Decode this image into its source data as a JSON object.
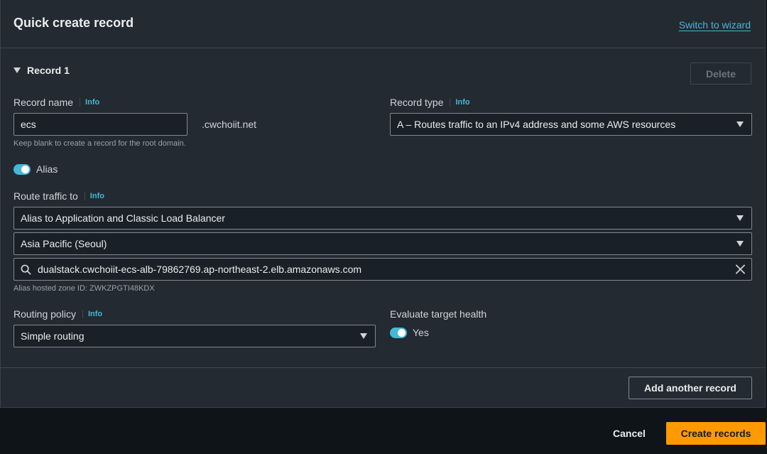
{
  "header": {
    "title": "Quick create record",
    "switch_link": "Switch to wizard"
  },
  "record": {
    "section_label": "Record 1",
    "delete_label": "Delete",
    "record_name": {
      "label": "Record name",
      "info": "Info",
      "value": "ecs",
      "suffix": ".cwchoiit.net",
      "hint": "Keep blank to create a record for the root domain."
    },
    "record_type": {
      "label": "Record type",
      "info": "Info",
      "value": "A – Routes traffic to an IPv4 address and some AWS resources"
    },
    "alias": {
      "label": "Alias",
      "enabled": true
    },
    "route_traffic": {
      "label": "Route traffic to",
      "info": "Info",
      "endpoint_type": "Alias to Application and Classic Load Balancer",
      "region": "Asia Pacific (Seoul)",
      "target": "dualstack.cwchoiit-ecs-alb-79862769.ap-northeast-2.elb.amazonaws.com",
      "hosted_zone": "Alias hosted zone ID: ZWKZPGTI48KDX"
    },
    "routing_policy": {
      "label": "Routing policy",
      "info": "Info",
      "value": "Simple routing"
    },
    "evaluate_health": {
      "label": "Evaluate target health",
      "toggle_label": "Yes",
      "enabled": true
    }
  },
  "actions": {
    "add_record": "Add another record",
    "cancel": "Cancel",
    "create": "Create records"
  },
  "colors": {
    "accent": "#44b9d6",
    "primary_button": "#ff9900"
  }
}
